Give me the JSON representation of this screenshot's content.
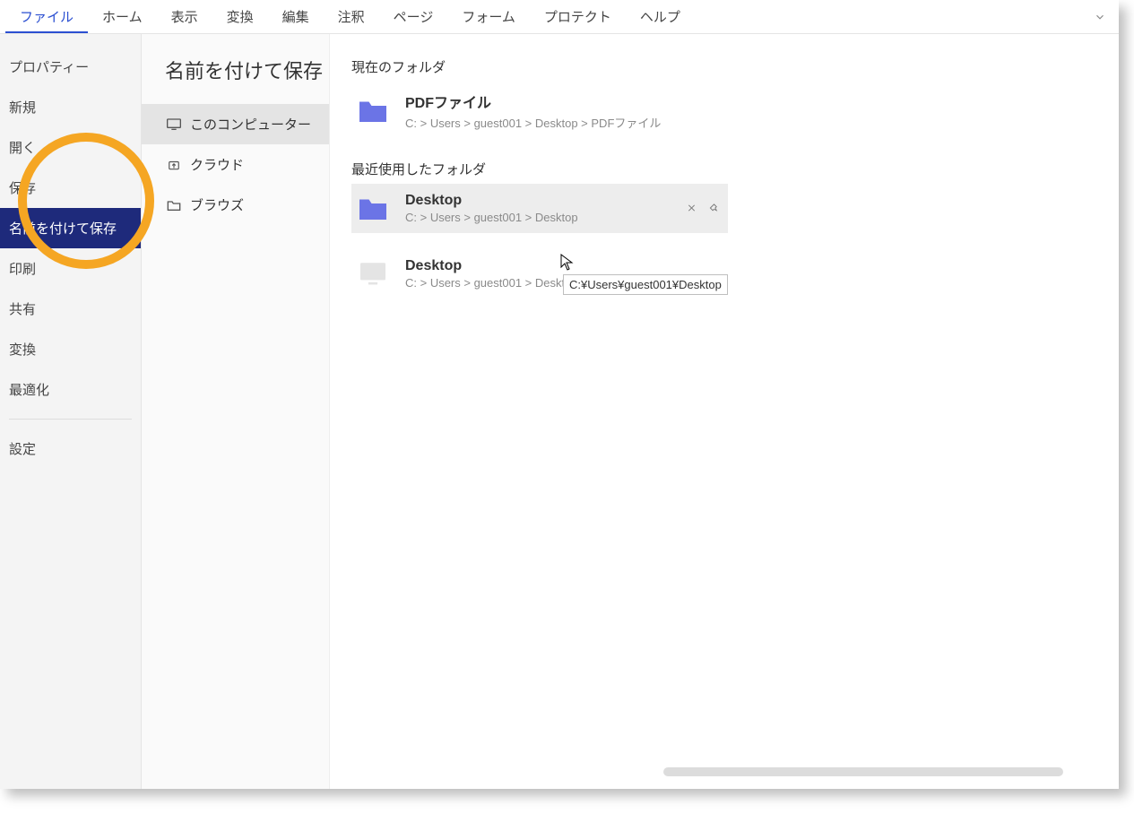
{
  "menubar": {
    "items": [
      "ファイル",
      "ホーム",
      "表示",
      "変換",
      "編集",
      "注釈",
      "ページ",
      "フォーム",
      "プロテクト",
      "ヘルプ"
    ],
    "active_index": 0
  },
  "sidebar": {
    "items": [
      "プロパティー",
      "新規",
      "開く",
      "保存",
      "名前を付けて保存",
      "印刷",
      "共有",
      "変換",
      "最適化"
    ],
    "active_index": 4,
    "settings": "設定"
  },
  "middle": {
    "title": "名前を付けて保存",
    "locations": [
      {
        "label": "このコンピューター",
        "icon": "monitor",
        "selected": true
      },
      {
        "label": "クラウド",
        "icon": "cloud-up",
        "selected": false
      },
      {
        "label": "ブラウズ",
        "icon": "folder",
        "selected": false
      }
    ]
  },
  "main": {
    "current_folder_title": "現在のフォルダ",
    "recent_folder_title": "最近使用したフォルダ",
    "current_folders": [
      {
        "name": "PDFファイル",
        "path": "C: > Users > guest001 > Desktop > PDFファイル",
        "icon": "folder-blue"
      }
    ],
    "recent_folders": [
      {
        "name": "Desktop",
        "path": "C: > Users > guest001 > Desktop",
        "icon": "folder-blue",
        "hovered": true
      },
      {
        "name": "Desktop",
        "path": "C: > Users > guest001 > Desktop",
        "icon": "monitor-grey",
        "hovered": false
      }
    ],
    "tooltip": "C:¥Users¥guest001¥Desktop"
  }
}
